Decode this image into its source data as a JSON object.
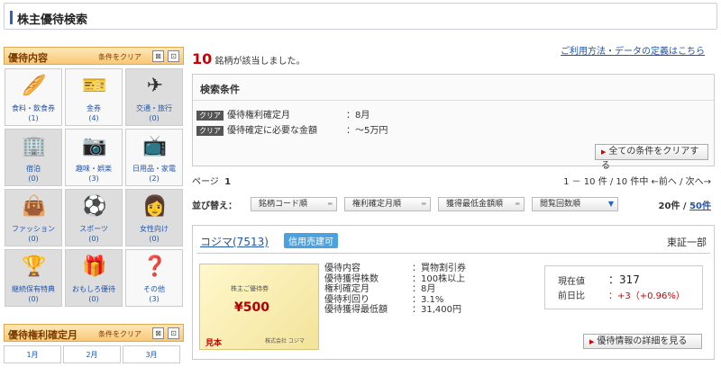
{
  "page": {
    "title": "株主優待検索"
  },
  "sidebar": {
    "section1": {
      "title": "優待内容",
      "clear": "条件をクリア"
    },
    "categories": [
      {
        "label": "食料・飲食券",
        "count": "(1)",
        "icon": "bread-icon"
      },
      {
        "label": "金券",
        "count": "(4)",
        "icon": "ticket-icon"
      },
      {
        "label": "交通・旅行",
        "count": "(0)",
        "icon": "airplane-icon"
      },
      {
        "label": "宿泊",
        "count": "(0)",
        "icon": "hotel-icon"
      },
      {
        "label": "趣味・娯楽",
        "count": "(3)",
        "icon": "camera-icon"
      },
      {
        "label": "日用品・家電",
        "count": "(2)",
        "icon": "microwave-icon"
      },
      {
        "label": "ファッション",
        "count": "(0)",
        "icon": "bag-icon"
      },
      {
        "label": "スポーツ",
        "count": "(0)",
        "icon": "ball-icon"
      },
      {
        "label": "女性向け",
        "count": "(0)",
        "icon": "woman-icon"
      },
      {
        "label": "継続保有特典",
        "count": "(0)",
        "icon": "trophy-icon"
      },
      {
        "label": "おもしろ優待",
        "count": "(0)",
        "icon": "gift-icon"
      },
      {
        "label": "その他",
        "count": "(3)",
        "icon": "question-box-icon"
      }
    ],
    "section2": {
      "title": "優待権利確定月",
      "clear": "条件をクリア"
    },
    "months": [
      "1月",
      "2月",
      "3月"
    ]
  },
  "results": {
    "count": "10",
    "count_suffix": "銘柄が該当しました。",
    "help_link": "ご利用方法・データの定義はこちら"
  },
  "conditions": {
    "header": "検索条件",
    "tag": "クリア",
    "rows": [
      {
        "label": "優待権利確定月",
        "value": "：8月"
      },
      {
        "label": "優待確定に必要な金額",
        "value": "：～5万円"
      }
    ],
    "clear_all": "全ての条件をクリアする"
  },
  "pager": {
    "page_label": "ページ",
    "page": "1",
    "range": "1 － 10 件 / 10 件中 ←前へ / 次へ→"
  },
  "sort": {
    "label": "並び替え：",
    "buttons": [
      "銘柄コード順",
      "権利確定月順",
      "獲得最低金額順",
      "閲覧回数順"
    ],
    "per_page": "20件",
    "per_page2": "50件"
  },
  "card": {
    "name": "コジマ(7513)",
    "badge": "信用売建可",
    "market": "東証一部",
    "thumb": {
      "top": "株主ご優待券",
      "amount": "¥500",
      "stamp": "見本",
      "company": "株式会社 コジマ"
    },
    "details": [
      {
        "k": "優待内容",
        "v": "：買物割引券"
      },
      {
        "k": "優待獲得株数",
        "v": "：100株以上"
      },
      {
        "k": "権利確定月",
        "v": "：8月"
      },
      {
        "k": "優待利回り",
        "v": "：3.1%"
      },
      {
        "k": "優待獲得最低額",
        "v": "：31,400円"
      }
    ],
    "price_label": "現在値",
    "price": "：317",
    "change_label": "前日比",
    "change": "：+3（+0.96%）",
    "detail_button": "優待情報の詳細を見る"
  }
}
